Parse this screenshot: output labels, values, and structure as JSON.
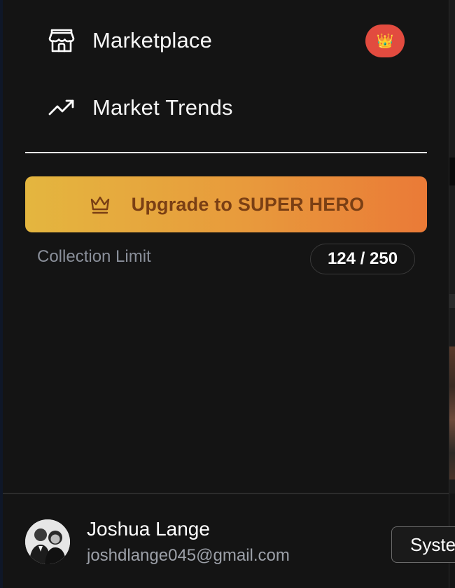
{
  "sidebar": {
    "items": [
      {
        "label": "Marketplace",
        "icon": "storefront-icon"
      },
      {
        "label": "Market Trends",
        "icon": "trending-up-icon"
      }
    ],
    "marketplace_badge": {
      "icon": "crown-emoji-icon",
      "text": "👑",
      "color": "#e24b3f"
    }
  },
  "upgrade": {
    "label": "Upgrade to SUPER HERO",
    "icon": "crown-outline-icon",
    "gradient": [
      "#e4b63f",
      "#ea7a37"
    ],
    "text_color": "#7a3f14"
  },
  "collection_limit": {
    "label": "Collection Limit",
    "value": "124 / 250",
    "used": 124,
    "max": 250
  },
  "user": {
    "name": "Joshua Lange",
    "email": "joshdlange045@gmail.com",
    "avatar": "avatar-photo"
  },
  "system_button": {
    "label": "System"
  }
}
